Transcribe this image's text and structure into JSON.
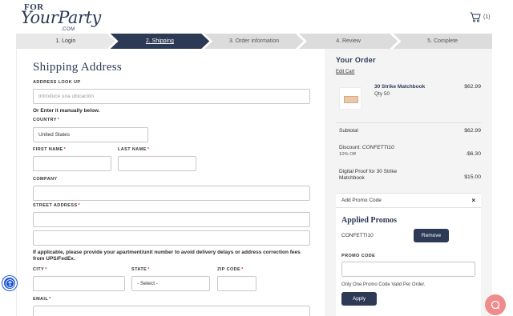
{
  "header": {
    "logo": {
      "line1": "FOR",
      "line2": "YourParty",
      "line3": ".COM"
    },
    "cart": {
      "icon": "cart-icon",
      "count": "(1)"
    }
  },
  "steps": [
    {
      "label": "1. Login",
      "state": "done"
    },
    {
      "label": "2. Shipping",
      "state": "active"
    },
    {
      "label": "3. Order information",
      "state": "upcoming"
    },
    {
      "label": "4. Review",
      "state": "upcoming"
    },
    {
      "label": "5. Complete",
      "state": "upcoming"
    }
  ],
  "shipping": {
    "title": "Shipping Address",
    "address_lookup": {
      "label": "ADDRESS LOOK UP",
      "placeholder": "Introduce una ubicación"
    },
    "manual_note": "Or Enter it manually below.",
    "country": {
      "label": "COUNTRY",
      "value": "United States"
    },
    "first_name": {
      "label": "FIRST NAME"
    },
    "last_name": {
      "label": "LAST NAME"
    },
    "company": {
      "label": "COMPANY"
    },
    "street": {
      "label": "STREET ADDRESS"
    },
    "apartment_note": "If applicable, please provide your apartment/unit number to avoid delivery delays or address correction fees from UPS/FedEx.",
    "city": {
      "label": "CITY"
    },
    "state": {
      "label": "STATE",
      "value": "- Select -"
    },
    "zip": {
      "label": "ZIP CODE"
    },
    "email": {
      "label": "EMAIL"
    }
  },
  "order": {
    "title": "Your Order",
    "edit_cart": "Edit Cart",
    "item": {
      "name": "30 Strike Matchbook",
      "qty": "Qty 50",
      "price": "$62.99"
    },
    "subtotal": {
      "label": "Subtotal",
      "value": "$62.99"
    },
    "discount": {
      "label": "Discount:",
      "code": "CONFETTI10",
      "detail": "10% Off",
      "value": "-$6.30"
    },
    "proof": {
      "label": "Digital Proof for 30 Strike Matchbook",
      "value": "$15.00"
    },
    "promo": {
      "header": "Add Promo Code",
      "applied_title": "Applied Promos",
      "applied_code": "CONFETTI10",
      "remove_label": "Remove",
      "input_label": "PROMO CODE",
      "note": "Only One Promo Code Valid Per Order.",
      "apply_label": "Apply"
    }
  },
  "colors": {
    "brand": "#2d3a55",
    "chat": "#f08b8b",
    "accessibility": "#1a53d6"
  }
}
